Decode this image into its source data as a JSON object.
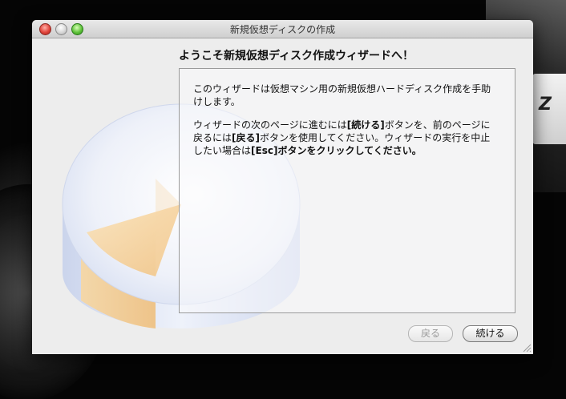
{
  "window": {
    "title": "新規仮想ディスクの作成"
  },
  "wizard": {
    "heading": "ようこそ新規仮想ディスク作成ウィザードへ！",
    "para1": "このウィザードは仮想マシン用の新規仮想ハードディスク作成を手助けします。",
    "para2_a": "ウィザードの次のページに進むには",
    "para2_b": "[続ける]",
    "para2_c": "ボタンを、前のページに戻るには",
    "para2_d": "[戻る]",
    "para2_e": "ボタンを使用してください。ウィザードの実行を中止したい場合は",
    "para2_f": "[Esc]ボタンをクリックしてください。"
  },
  "buttons": {
    "back_label": "戻る",
    "next_label": "続ける",
    "back_enabled": false
  },
  "background": {
    "plate_text": "Z"
  },
  "colors": {
    "disk_accent": "#f3c98c",
    "disk_body": "#dfe6f5",
    "close": "#e0443b",
    "zoom": "#5fc23a"
  },
  "icons": [
    "close-icon",
    "minimize-icon",
    "zoom-icon",
    "disk-icon",
    "resize-grip-icon"
  ]
}
